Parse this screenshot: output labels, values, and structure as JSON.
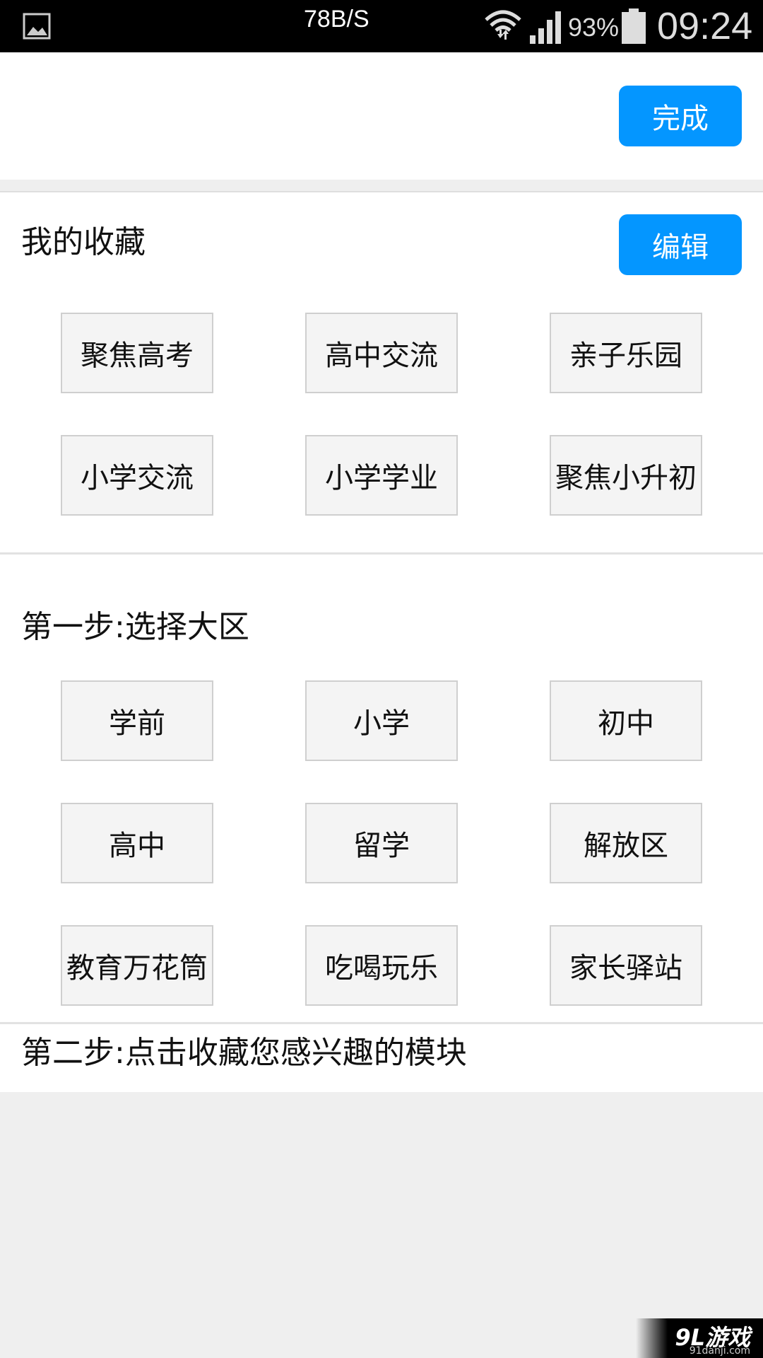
{
  "status_bar": {
    "network_speed": "78B/S",
    "battery_percent": "93%",
    "time": "09:24",
    "icons": [
      "image-icon",
      "wifi-icon",
      "signal-icon",
      "battery-icon"
    ]
  },
  "header": {
    "done_label": "完成"
  },
  "favorites": {
    "title": "我的收藏",
    "edit_label": "编辑",
    "items": [
      "聚焦高考",
      "高中交流",
      "亲子乐园",
      "小学交流",
      "小学学业",
      "聚焦小升初"
    ]
  },
  "step1": {
    "title": "第一步:选择大区",
    "regions": [
      "学前",
      "小学",
      "初中",
      "高中",
      "留学",
      "解放区",
      "教育万花筒",
      "吃喝玩乐",
      "家长驿站"
    ]
  },
  "step2": {
    "title": "第二步:点击收藏您感兴趣的模块"
  },
  "watermark": {
    "logo": "9L游戏",
    "url": "91danji.com"
  },
  "colors": {
    "accent": "#0496ff",
    "tile_bg": "#f4f4f4",
    "tile_border": "#cfcfcf",
    "page_bg": "#efefef"
  }
}
